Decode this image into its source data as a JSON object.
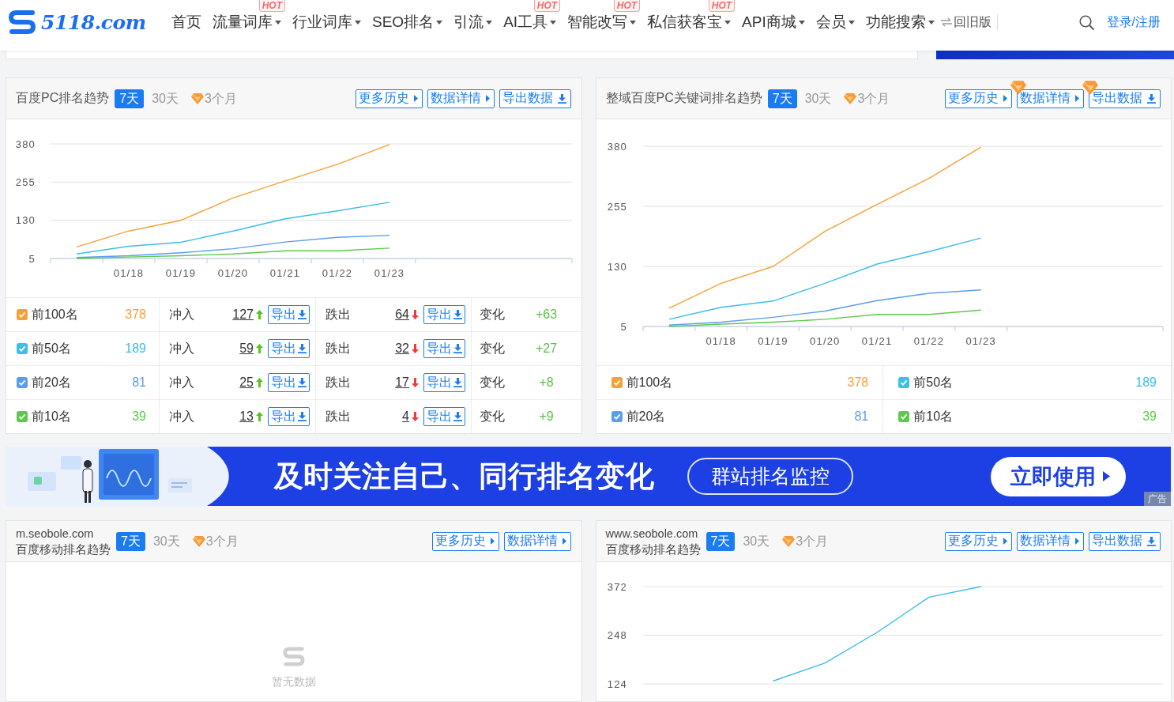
{
  "nav": {
    "logo": "5118.com",
    "items": [
      {
        "label": "首页",
        "dropdown": false
      },
      {
        "label": "流量词库",
        "dropdown": true,
        "badge": "HOT"
      },
      {
        "label": "行业词库",
        "dropdown": true
      },
      {
        "label": "SEO排名",
        "dropdown": true
      },
      {
        "label": "引流",
        "dropdown": true
      },
      {
        "label": "AI工具",
        "dropdown": true,
        "badge": "HOT"
      },
      {
        "label": "智能改写",
        "dropdown": true,
        "badge": "HOT"
      },
      {
        "label": "私信获客宝",
        "dropdown": true,
        "badge": "HOT"
      },
      {
        "label": "API商城",
        "dropdown": true
      },
      {
        "label": "会员",
        "dropdown": true
      },
      {
        "label": "功能搜索",
        "dropdown": true
      }
    ],
    "switch": "回旧版",
    "login": "登录/注册"
  },
  "top_panels": [
    {
      "kind": "stats",
      "title": "百度PC排名趋势",
      "ranges": [
        {
          "label": "7天",
          "selected": true,
          "premium": false
        },
        {
          "label": "30天",
          "selected": false,
          "premium": false
        },
        {
          "label": "3个月",
          "selected": false,
          "premium": true
        }
      ],
      "buttons": [
        {
          "label": "更多历史",
          "kind": "link",
          "premium": false
        },
        {
          "label": "数据详情",
          "kind": "link",
          "premium": false
        },
        {
          "label": "导出数据",
          "kind": "export",
          "premium": false
        }
      ],
      "chart_data": {
        "type": "line",
        "categories": [
          null,
          "01/18",
          "01/19",
          "01/20",
          "01/21",
          "01/22",
          "01/23",
          null,
          null,
          null
        ],
        "ylim": [
          5,
          380
        ],
        "yticks": [
          5,
          130,
          255,
          380
        ],
        "series": [
          {
            "color": "#f7a035",
            "values": [
              43,
              95,
              130,
              203,
              259,
              313,
              378,
              null,
              null,
              null
            ]
          },
          {
            "color": "#3dbde9",
            "values": [
              20,
              45,
              58,
              95,
              135,
              161,
              189,
              null,
              null,
              null
            ]
          },
          {
            "color": "#5b9cf0",
            "values": [
              8,
              14,
              24,
              37,
              59,
              74,
              81,
              null,
              null,
              null
            ]
          },
          {
            "color": "#5cc94b",
            "values": [
              5,
              10,
              14,
              20,
              30,
              30,
              39,
              null,
              null,
              null
            ]
          }
        ]
      },
      "rows": [
        {
          "label": "前100名",
          "color": "#f7a035",
          "checked": true,
          "count": "378",
          "entered": {
            "label": "冲入",
            "value": "127",
            "button": "导出"
          },
          "dropped": {
            "label": "跌出",
            "value": "64",
            "button": "导出"
          },
          "change": {
            "label": "变化",
            "value": "+63"
          }
        },
        {
          "label": "前50名",
          "color": "#3dbde9",
          "checked": true,
          "count": "189",
          "entered": {
            "label": "冲入",
            "value": "59",
            "button": "导出"
          },
          "dropped": {
            "label": "跌出",
            "value": "32",
            "button": "导出"
          },
          "change": {
            "label": "变化",
            "value": "+27"
          }
        },
        {
          "label": "前20名",
          "color": "#5b9cf0",
          "checked": true,
          "count": "81",
          "entered": {
            "label": "冲入",
            "value": "25",
            "button": "导出"
          },
          "dropped": {
            "label": "跌出",
            "value": "17",
            "button": "导出"
          },
          "change": {
            "label": "变化",
            "value": "+8"
          }
        },
        {
          "label": "前10名",
          "color": "#5cc94b",
          "checked": true,
          "count": "39",
          "entered": {
            "label": "冲入",
            "value": "13",
            "button": "导出"
          },
          "dropped": {
            "label": "跌出",
            "value": "4",
            "button": "导出"
          },
          "change": {
            "label": "变化",
            "value": "+9"
          }
        }
      ]
    },
    {
      "kind": "legend",
      "title": "整域百度PC关键词排名趋势",
      "ranges": [
        {
          "label": "7天",
          "selected": true,
          "premium": false
        },
        {
          "label": "30天",
          "selected": false,
          "premium": false
        },
        {
          "label": "3个月",
          "selected": false,
          "premium": true
        }
      ],
      "buttons": [
        {
          "label": "更多历史",
          "kind": "link",
          "premium": false
        },
        {
          "label": "数据详情",
          "kind": "link",
          "premium": true
        },
        {
          "label": "导出数据",
          "kind": "export",
          "premium": true
        }
      ],
      "chart_data": {
        "type": "line",
        "categories": [
          null,
          "01/18",
          "01/19",
          "01/20",
          "01/21",
          "01/22",
          "01/23",
          null,
          null,
          null
        ],
        "ylim": [
          5,
          380
        ],
        "yticks": [
          5,
          130,
          255,
          380
        ],
        "series": [
          {
            "color": "#f7a035",
            "values": [
              43,
              95,
              130,
              203,
              259,
              313,
              378,
              null,
              null,
              null
            ]
          },
          {
            "color": "#3dbde9",
            "values": [
              20,
              45,
              58,
              95,
              135,
              161,
              189,
              null,
              null,
              null
            ]
          },
          {
            "color": "#5b9cf0",
            "values": [
              8,
              14,
              24,
              37,
              59,
              74,
              81,
              null,
              null,
              null
            ]
          },
          {
            "color": "#5cc94b",
            "values": [
              5,
              10,
              14,
              20,
              30,
              30,
              39,
              null,
              null,
              null
            ]
          }
        ]
      },
      "legend": [
        {
          "label": "前100名",
          "color": "#f7a035",
          "checked": true,
          "count": "378"
        },
        {
          "label": "前50名",
          "color": "#3dbde9",
          "checked": true,
          "count": "189"
        },
        {
          "label": "前20名",
          "color": "#5b9cf0",
          "checked": true,
          "count": "81"
        },
        {
          "label": "前10名",
          "color": "#5cc94b",
          "checked": true,
          "count": "39"
        }
      ]
    }
  ],
  "banner": {
    "headline": "及时关注自己、同行排名变化",
    "tag": "群站排名监控",
    "cta": "立即使用",
    "ad_label": "广告"
  },
  "bottom_panels": [
    {
      "kind": "empty",
      "domain": "m.seobole.com",
      "title": "百度移动排名趋势",
      "ranges": [
        {
          "label": "7天",
          "selected": true,
          "premium": false
        },
        {
          "label": "30天",
          "selected": false,
          "premium": false
        },
        {
          "label": "3个月",
          "selected": false,
          "premium": true
        }
      ],
      "buttons": [
        {
          "label": "更多历史",
          "kind": "link",
          "premium": false
        },
        {
          "label": "数据详情",
          "kind": "link",
          "premium": false
        }
      ],
      "empty_text": "暂无数据"
    },
    {
      "kind": "chart",
      "domain": "www.seobole.com",
      "title": "百度移动排名趋势",
      "ranges": [
        {
          "label": "7天",
          "selected": true,
          "premium": false
        },
        {
          "label": "30天",
          "selected": false,
          "premium": false
        },
        {
          "label": "3个月",
          "selected": false,
          "premium": true
        }
      ],
      "buttons": [
        {
          "label": "更多历史",
          "kind": "link",
          "premium": false
        },
        {
          "label": "数据详情",
          "kind": "link",
          "premium": false
        },
        {
          "label": "导出数据",
          "kind": "export",
          "premium": false
        }
      ],
      "chart_data": {
        "type": "line",
        "categories": [
          null,
          null,
          null,
          null,
          null,
          null,
          null,
          null,
          null,
          null
        ],
        "ylim": [
          124,
          372
        ],
        "yticks": [
          124,
          248,
          372
        ],
        "series": [
          {
            "color": "#3dbde9",
            "values": [
              null,
              null,
              131,
              177,
              255,
              345,
              372,
              null,
              null,
              null
            ]
          }
        ]
      }
    }
  ]
}
